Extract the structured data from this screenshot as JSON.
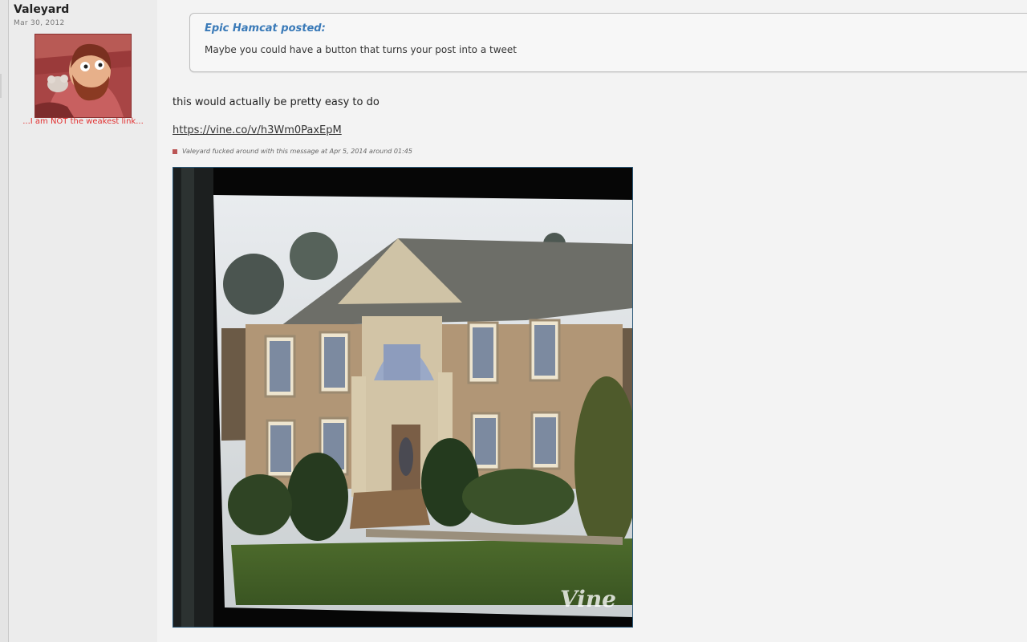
{
  "user": {
    "name": "Valeyard",
    "join_date": "Mar 30, 2012",
    "title": "...I am NOT the weakest link..."
  },
  "quote": {
    "author": "Epic Hamcat posted:",
    "text": "Maybe you could have a button that turns your post into a tweet"
  },
  "post": {
    "text": "this would actually be pretty easy to do",
    "link": "https://vine.co/v/h3Wm0PaxEpM",
    "edit_note": "Valeyard fucked around with this message at Apr 5, 2014 around 01:45"
  },
  "video": {
    "logo": "Vine"
  },
  "colors": {
    "quote_author": "#3a7ab8",
    "user_title": "#e23030",
    "avatar_bg": "#b04848"
  }
}
